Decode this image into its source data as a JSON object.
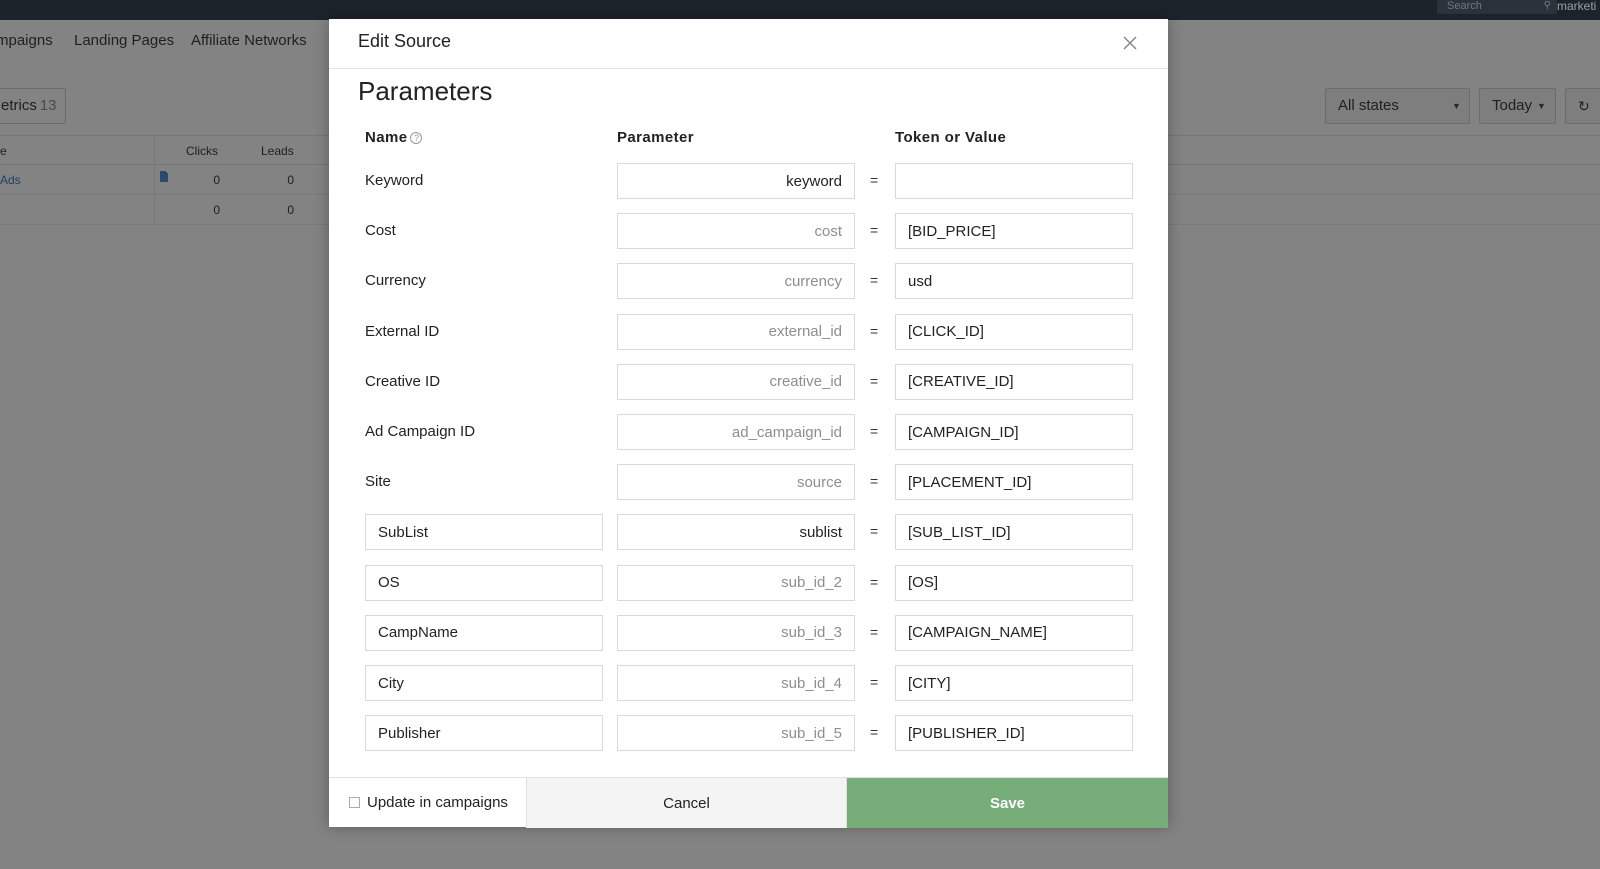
{
  "topbar": {
    "search_placeholder": "Search",
    "search_icon": "magnifier-icon",
    "user_label": "marketi"
  },
  "nav": {
    "items": [
      "mpaigns",
      "Landing Pages",
      "Affiliate Networks"
    ]
  },
  "toolbar": {
    "metrics_label": "etrics",
    "metrics_count": "13",
    "states_select": "All states",
    "date_select": "Today",
    "refresh_icon": "refresh-icon"
  },
  "table": {
    "headers": [
      "e",
      "Clicks",
      "Leads"
    ],
    "rows": [
      {
        "name": "Ads",
        "clicks": "0",
        "leads": "0"
      },
      {
        "name": "",
        "clicks": "0",
        "leads": "0"
      }
    ]
  },
  "modal": {
    "title": "Edit Source",
    "close_icon": "close-icon",
    "section_title": "Parameters",
    "columns": {
      "name": "Name",
      "parameter": "Parameter",
      "token": "Token or Value"
    },
    "help_icon": "question-circle-icon",
    "equals": "=",
    "rows": [
      {
        "name": "Keyword",
        "name_editable": false,
        "param_value": "keyword",
        "param_placeholder": "",
        "token": ""
      },
      {
        "name": "Cost",
        "name_editable": false,
        "param_value": "",
        "param_placeholder": "cost",
        "token": "[BID_PRICE]"
      },
      {
        "name": "Currency",
        "name_editable": false,
        "param_value": "",
        "param_placeholder": "currency",
        "token": "usd"
      },
      {
        "name": "External ID",
        "name_editable": false,
        "param_value": "",
        "param_placeholder": "external_id",
        "token": "[CLICK_ID]"
      },
      {
        "name": "Creative ID",
        "name_editable": false,
        "param_value": "",
        "param_placeholder": "creative_id",
        "token": "[CREATIVE_ID]"
      },
      {
        "name": "Ad Campaign ID",
        "name_editable": false,
        "param_value": "",
        "param_placeholder": "ad_campaign_id",
        "token": "[CAMPAIGN_ID]"
      },
      {
        "name": "Site",
        "name_editable": false,
        "param_value": "",
        "param_placeholder": "source",
        "token": "[PLACEMENT_ID]"
      },
      {
        "name": "SubList",
        "name_editable": true,
        "param_value": "sublist",
        "param_placeholder": "",
        "token": "[SUB_LIST_ID]"
      },
      {
        "name": "OS",
        "name_editable": true,
        "param_value": "",
        "param_placeholder": "sub_id_2",
        "token": "[OS]"
      },
      {
        "name": "CampName",
        "name_editable": true,
        "param_value": "",
        "param_placeholder": "sub_id_3",
        "token": "[CAMPAIGN_NAME]"
      },
      {
        "name": "City",
        "name_editable": true,
        "param_value": "",
        "param_placeholder": "sub_id_4",
        "token": "[CITY]"
      },
      {
        "name": "Publisher",
        "name_editable": true,
        "param_value": "",
        "param_placeholder": "sub_id_5",
        "token": "[PUBLISHER_ID]"
      }
    ],
    "footer": {
      "update_label": "Update in campaigns",
      "update_checked": false,
      "cancel_label": "Cancel",
      "save_label": "Save"
    }
  },
  "colors": {
    "save_button": "#76ad78",
    "overlay": "#838383",
    "topbar": "#1d232b"
  }
}
